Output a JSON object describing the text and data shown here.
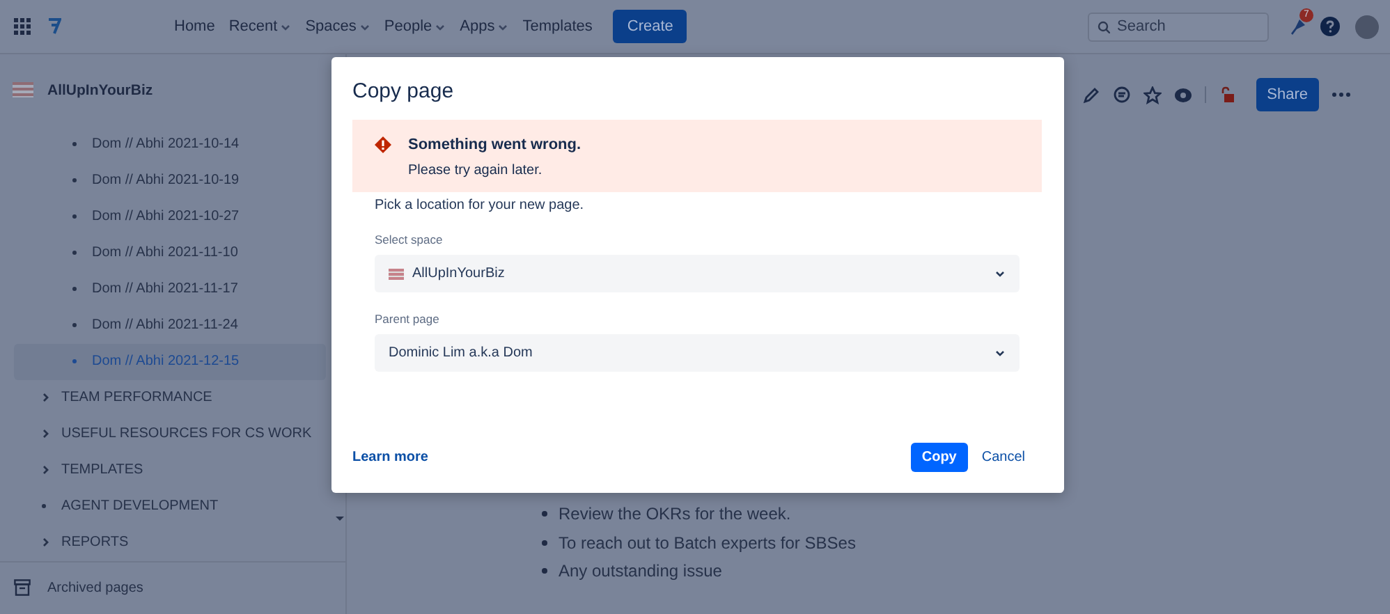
{
  "header": {
    "nav": [
      {
        "label": "Home",
        "dropdown": false
      },
      {
        "label": "Recent",
        "dropdown": true
      },
      {
        "label": "Spaces",
        "dropdown": true
      },
      {
        "label": "People",
        "dropdown": true
      },
      {
        "label": "Apps",
        "dropdown": true
      },
      {
        "label": "Templates",
        "dropdown": false
      }
    ],
    "create_button": "Create",
    "search": {
      "placeholder": "Search"
    },
    "notification_count": "7"
  },
  "sidebar": {
    "space_name": "AllUpInYourBiz",
    "items": [
      {
        "label": "Dom // Abhi 2021-10-14",
        "kind": "child",
        "selected": false
      },
      {
        "label": "Dom // Abhi 2021-10-19",
        "kind": "child",
        "selected": false
      },
      {
        "label": "Dom // Abhi 2021-10-27",
        "kind": "child",
        "selected": false
      },
      {
        "label": "Dom // Abhi 2021-11-10",
        "kind": "child",
        "selected": false
      },
      {
        "label": "Dom // Abhi 2021-11-17",
        "kind": "child",
        "selected": false
      },
      {
        "label": "Dom // Abhi 2021-11-24",
        "kind": "child",
        "selected": false
      },
      {
        "label": "Dom // Abhi 2021-12-15",
        "kind": "child",
        "selected": true
      },
      {
        "label": "TEAM PERFORMANCE",
        "kind": "folder",
        "selected": false
      },
      {
        "label": "USEFUL RESOURCES FOR CS WORK",
        "kind": "folder",
        "selected": false
      },
      {
        "label": "TEMPLATES",
        "kind": "folder",
        "selected": false
      },
      {
        "label": "AGENT DEVELOPMENT",
        "kind": "leaf",
        "selected": false
      },
      {
        "label": "REPORTS",
        "kind": "folder",
        "selected": false
      }
    ],
    "archived": "Archived pages"
  },
  "page": {
    "share_button": "Share",
    "bullets": [
      "Review the OKRs for the week.",
      "To reach out to Batch experts for SBSes",
      "Any outstanding issue"
    ]
  },
  "dialog": {
    "title": "Copy page",
    "error": {
      "title": "Something went wrong.",
      "message": "Please try again later."
    },
    "intro": "Pick a location for your new page.",
    "fields": [
      {
        "label": "Select space",
        "value": "AllUpInYourBiz",
        "has_logo": true
      },
      {
        "label": "Parent page",
        "value": "Dominic Lim a.k.a Dom",
        "has_logo": false
      }
    ],
    "learn_more": "Learn more",
    "primary_button": "Copy",
    "cancel_button": "Cancel"
  }
}
